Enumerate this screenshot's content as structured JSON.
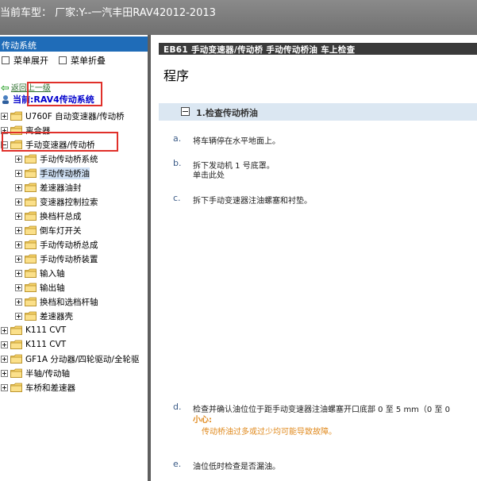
{
  "topbar": {
    "text": "当前车型： 厂家:Y--一汽丰田RAV42012-2013"
  },
  "left": {
    "header": "传动系统",
    "expand_all": "菜单展开",
    "collapse_all": "菜单折叠",
    "back_label": "返回上一级",
    "current_label": "当前:RAV4传动系统",
    "tree": [
      {
        "label": "U760F 自动变速器/传动桥",
        "level": 0
      },
      {
        "label": "离合器",
        "level": 0
      },
      {
        "label": "手动变速器/传动桥",
        "level": 0,
        "expanded": true
      },
      {
        "label": "手动传动桥系统",
        "level": 1
      },
      {
        "label": "手动传动桥油",
        "level": 1,
        "selected": true
      },
      {
        "label": "差速器油封",
        "level": 1
      },
      {
        "label": "变速器控制拉索",
        "level": 1
      },
      {
        "label": "换档杆总成",
        "level": 1
      },
      {
        "label": "倒车灯开关",
        "level": 1
      },
      {
        "label": "手动传动桥总成",
        "level": 1
      },
      {
        "label": "手动传动桥装置",
        "level": 1
      },
      {
        "label": "输入轴",
        "level": 1
      },
      {
        "label": "输出轴",
        "level": 1
      },
      {
        "label": "换档和选档杆轴",
        "level": 1
      },
      {
        "label": "差速器壳",
        "level": 1
      },
      {
        "label": "K111 CVT",
        "level": 0
      },
      {
        "label": "K111 CVT",
        "level": 0
      },
      {
        "label": "GF1A 分动器/四轮驱动/全轮驱",
        "level": 0
      },
      {
        "label": "半轴/传动轴",
        "level": 0
      },
      {
        "label": "车桥和差速器",
        "level": 0
      }
    ]
  },
  "right": {
    "header": "EB61 手动变速器/传动桥  手动传动桥油  车上检查",
    "title": "程序",
    "section": "1.检查传动桥油",
    "steps": {
      "a": {
        "letter": "a.",
        "text": "将车辆停在水平地面上。"
      },
      "b": {
        "letter": "b.",
        "text": "拆下发动机 1 号底罩。",
        "sub": "单击此处"
      },
      "c": {
        "letter": "c.",
        "text": "拆下手动变速器注油螺塞和衬垫。"
      },
      "d": {
        "letter": "d.",
        "text": "检查并确认油位位于距手动变速器注油螺塞开口底部 0 至 5 mm（0 至 0",
        "caution_title": "小心:",
        "caution_text": "传动桥油过多或过少均可能导致故障。"
      },
      "e": {
        "letter": "e.",
        "text": "油位低时检查是否漏油。"
      }
    }
  },
  "colors": {
    "header_blue": "#1f6cb8",
    "highlight_red": "#e0302a",
    "caution_orange": "#e08a1e",
    "section_bg": "#dbe7f2"
  }
}
